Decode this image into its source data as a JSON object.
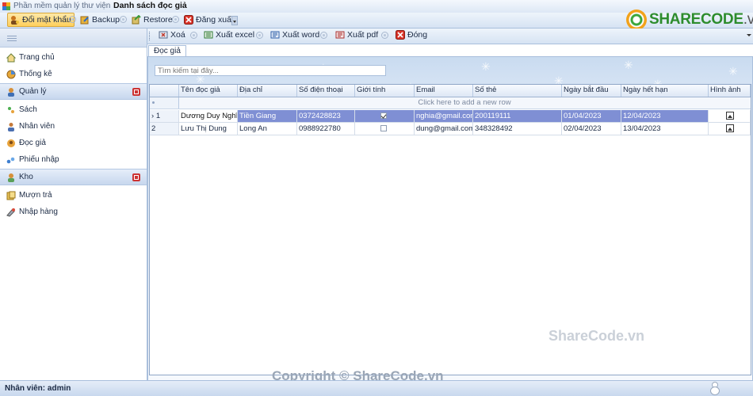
{
  "window": {
    "app_title": "Phần mềm quản lý thư viện",
    "document_title": "Danh sách đọc giả"
  },
  "toolbar": {
    "items": [
      {
        "label": "Đổi mật khẩu",
        "icon": "key-user-icon"
      },
      {
        "label": "Backup",
        "icon": "backup-icon"
      },
      {
        "label": "Restore",
        "icon": "restore-icon"
      },
      {
        "label": "Đăng xuất",
        "icon": "logout-icon"
      }
    ]
  },
  "logo": {
    "brand": "SHARECODE",
    "tld": ".vn"
  },
  "sidebar": {
    "items": [
      {
        "label": "Trang chủ",
        "icon": "home-icon",
        "group": false
      },
      {
        "label": "Thống kê",
        "icon": "chart-icon",
        "group": false
      },
      {
        "label": "Quản lý",
        "icon": "manage-icon",
        "group": true
      },
      {
        "label": "Sách",
        "icon": "book-icon",
        "group": false
      },
      {
        "label": "Nhân viên",
        "icon": "staff-icon",
        "group": false
      },
      {
        "label": "Đọc giả",
        "icon": "reader-icon",
        "group": false
      },
      {
        "label": "Phiếu nhập",
        "icon": "receipt-icon",
        "group": false
      },
      {
        "label": "Kho",
        "icon": "warehouse-icon",
        "group": true
      },
      {
        "label": "Mượn trả",
        "icon": "borrow-icon",
        "group": false
      },
      {
        "label": "Nhập hàng",
        "icon": "import-icon",
        "group": false
      }
    ]
  },
  "main_toolbar": {
    "items": [
      {
        "label": "Xoá",
        "icon": "delete-icon"
      },
      {
        "label": "Xuất excel",
        "icon": "excel-icon"
      },
      {
        "label": "Xuất word",
        "icon": "word-icon"
      },
      {
        "label": "Xuất pdf",
        "icon": "pdf-icon"
      },
      {
        "label": "Đóng",
        "icon": "close-icon"
      }
    ]
  },
  "tab": {
    "label": "Đọc giả"
  },
  "search": {
    "placeholder": "Tìm kiếm tại đây..."
  },
  "grid": {
    "columns": [
      "Tên đọc giả",
      "Địa chỉ",
      "Số điện thoại",
      "Giới tính",
      "Email",
      "Số thẻ",
      "Ngày bắt đầu",
      "Ngày hết hạn",
      "Hình ảnh"
    ],
    "new_row_text": "Click here to add a new row",
    "rows": [
      {
        "indicator": "1",
        "selected": true,
        "name": "Dương Duy Nghĩa",
        "address": "Tiền Giang",
        "phone": "0372428823",
        "gender_checked": true,
        "email": "nghia@gmail.com",
        "card": "200119111",
        "start": "01/04/2023",
        "end": "12/04/2023"
      },
      {
        "indicator": "2",
        "selected": false,
        "name": "Lưu Thị Dung",
        "address": "Long An",
        "phone": "0988922780",
        "gender_checked": false,
        "email": "dung@gmail.com",
        "card": "348328492",
        "start": "02/04/2023",
        "end": "13/04/2023"
      }
    ]
  },
  "watermarks": {
    "center": "ShareCode.vn",
    "copyright": "Copyright © ShareCode.vn"
  },
  "status": {
    "text": "Nhân viên: admin"
  }
}
